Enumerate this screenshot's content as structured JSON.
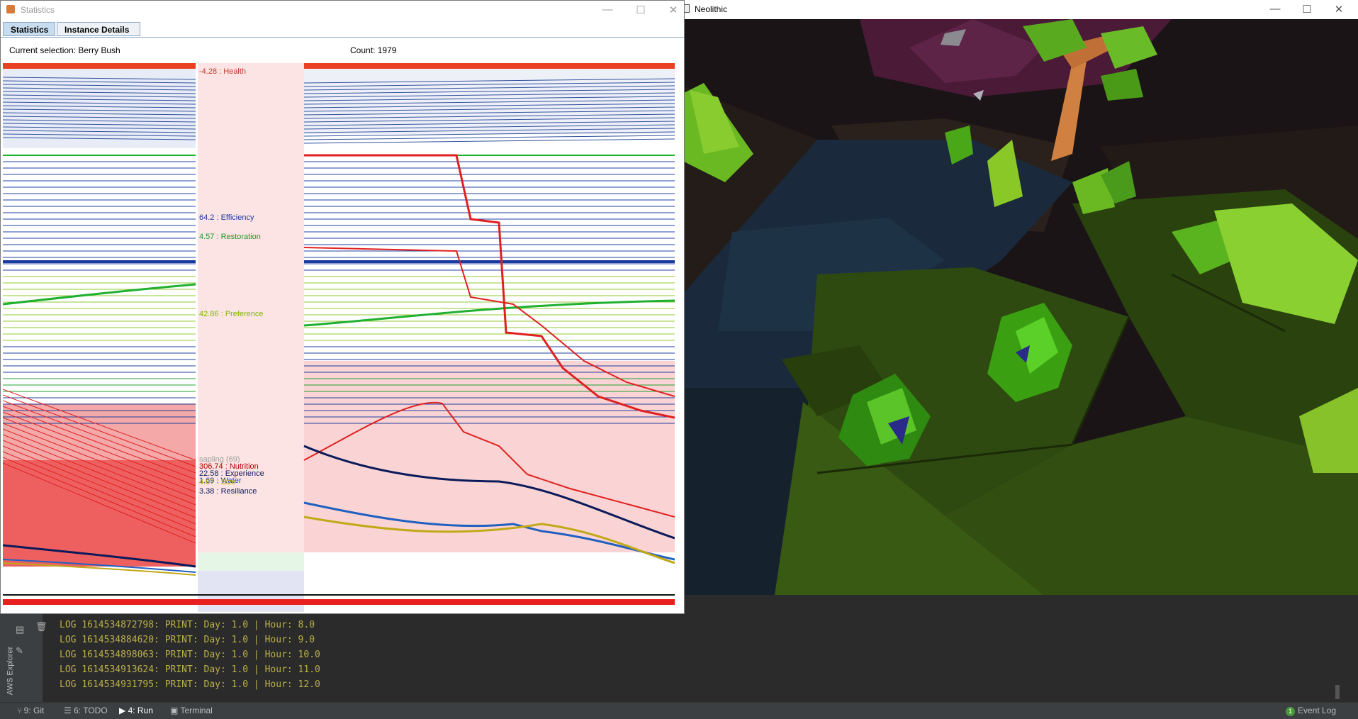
{
  "stats_window": {
    "title": "Statistics",
    "tabs": [
      {
        "label": "Statistics"
      },
      {
        "label": "Instance Details"
      }
    ],
    "current_selection": "Current selection: Berry Bush",
    "count": "Count: 1979",
    "series_labels": [
      {
        "text": "-4.28 : Health",
        "color": "#c0392b"
      },
      {
        "text": "64.2 : Efficiency",
        "color": "#1a3a9a"
      },
      {
        "text": "4.57 : Restoration",
        "color": "#1a9a2a"
      },
      {
        "text": "42.86 : Preference",
        "color": "#7ab800"
      },
      {
        "text": "sapling (69)",
        "color": "#9aa09a"
      },
      {
        "text": "306.74 : Nutrition",
        "color": "#b00000"
      },
      {
        "text": "22.58 : Experience",
        "color": "#0a1a5a"
      },
      {
        "text": "1.69 : Water",
        "color": "#1a4ab0"
      },
      {
        "text": "4.67 : Size",
        "color": "#b0a000"
      },
      {
        "text": "3.38 : Resiliance",
        "color": "#0a1a5a"
      }
    ]
  },
  "neo_window": {
    "title": "Neolithic"
  },
  "console": {
    "lines": [
      "LOG 1614534872798: PRINT: Day: 1.0 | Hour: 8.0",
      "LOG 1614534884620: PRINT: Day: 1.0 | Hour: 9.0",
      "LOG 1614534898063: PRINT: Day: 1.0 | Hour: 10.0",
      "LOG 1614534913624: PRINT: Day: 1.0 | Hour: 11.0",
      "LOG 1614534931795: PRINT: Day: 1.0 | Hour: 12.0"
    ]
  },
  "side_panel": {
    "aws_explorer": "AWS Explorer"
  },
  "status_bar": {
    "git": "9: Git",
    "todo": "6: TODO",
    "run": "4: Run",
    "terminal": "Terminal",
    "event_log": "Event Log",
    "event_count": "1"
  },
  "window_controls": {
    "minimize": "—",
    "maximize": "☐",
    "close": "✕"
  }
}
